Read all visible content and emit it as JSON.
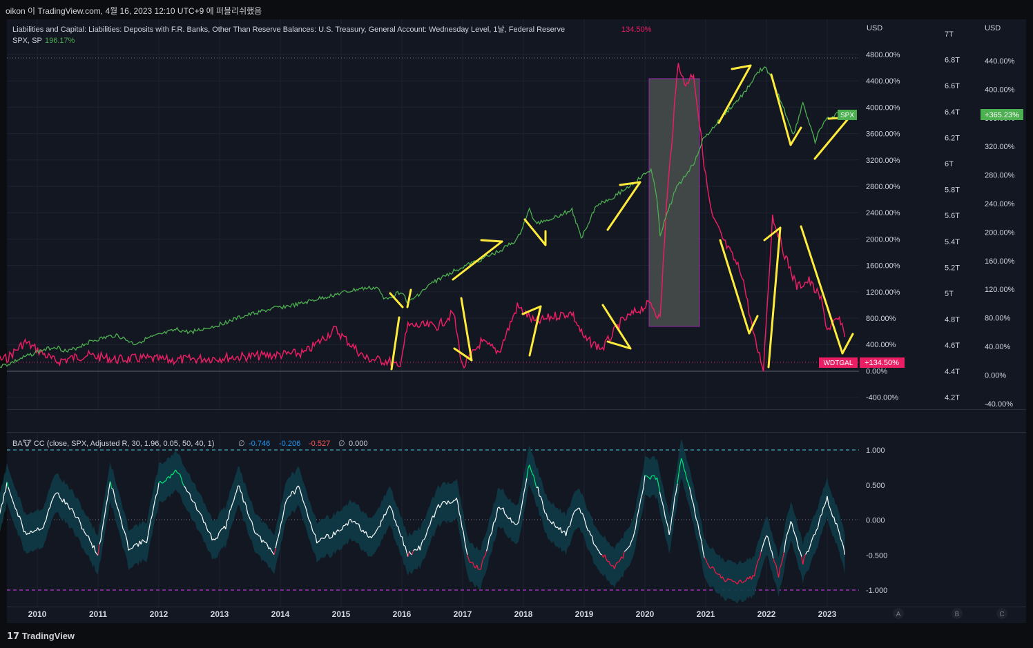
{
  "header": {
    "publish_line": "oikon 이 TradingView.com, 4월 16, 2023 12:10 UTC+9 에 퍼블리쉬했음"
  },
  "legend": {
    "main_series_title": "Liabilities and Capital: Liabilities: Deposits with F.R. Banks, Other Than Reserve Balances: U.S. Treasury, General Account: Wednesday Level, 1날, Federal Reserve",
    "main_series_value": "134.50%",
    "compare_series_title": "SPX, SP",
    "compare_series_value": "196.17%",
    "indicator_title": "BA🐮 CC (close, SPX, Adjusted R, 30, 1.96, 0.05, 50, 40, 1)",
    "indicator_v1": "-0.746",
    "indicator_v2": "-0.206",
    "indicator_v3": "-0.527",
    "indicator_v4": "0.000",
    "empty_symbol": "∅"
  },
  "axes": {
    "currency_label": "USD",
    "pct_axis_ticks": [
      "4800.00%",
      "4400.00%",
      "4000.00%",
      "3600.00%",
      "3200.00%",
      "2800.00%",
      "2400.00%",
      "2000.00%",
      "1600.00%",
      "1200.00%",
      "800.00%",
      "400.00%",
      "0.00%",
      "-400.00%"
    ],
    "t_axis_ticks": [
      "7T",
      "6.8T",
      "6.6T",
      "6.4T",
      "6.2T",
      "6T",
      "5.8T",
      "5.6T",
      "5.4T",
      "5.2T",
      "5T",
      "4.8T",
      "4.6T",
      "4.4T",
      "4.2T"
    ],
    "right_pct_ticks": [
      "440.00%",
      "400.00%",
      "360.00%",
      "320.00%",
      "280.00%",
      "240.00%",
      "200.00%",
      "160.00%",
      "120.00%",
      "80.00%",
      "40.00%",
      "0.00%",
      "-40.00%"
    ],
    "cc_axis_ticks": [
      "1.000",
      "0.500",
      "0.000",
      "-0.500",
      "-1.000"
    ],
    "years": [
      "2010",
      "2011",
      "2012",
      "2013",
      "2014",
      "2015",
      "2016",
      "2017",
      "2018",
      "2019",
      "2020",
      "2021",
      "2022",
      "2023"
    ],
    "scale_buttons": [
      "A",
      "B",
      "C"
    ]
  },
  "badges": {
    "spx_label": "SPX",
    "spx_value": "+365.23%",
    "wdtgal_label": "WDTGAL",
    "wdtgal_value": "+134.50%"
  },
  "colors": {
    "background": "#131722",
    "spx_line": "#4caf50",
    "wdtgal_line": "#e91e63",
    "arrow": "#ffeb3b",
    "highlight_box_fill": "#4a4f4e",
    "highlight_box_border": "#9c27b0",
    "cc_line": "#ffffff",
    "cc_positive": "#00e676",
    "cc_negative": "#ff1744",
    "cc_band": "#0e3b47",
    "upper_band_line": "#4dd0e1",
    "lower_band_line": "#e040fb"
  },
  "footer": {
    "brand": "TradingView"
  },
  "chart_data": [
    {
      "type": "line",
      "series": [
        {
          "name": "SPX, SP",
          "x": [
            2009.0,
            2009.5,
            2010.0,
            2010.3,
            2010.5,
            2010.9,
            2011.3,
            2011.6,
            2011.8,
            2012.3,
            2012.5,
            2012.9,
            2013.3,
            2013.6,
            2013.9,
            2014.3,
            2014.6,
            2014.9,
            2015.3,
            2015.6,
            2015.7,
            2016.0,
            2016.1,
            2016.5,
            2016.9,
            2017.3,
            2017.6,
            2017.9,
            2018.1,
            2018.2,
            2018.5,
            2018.8,
            2018.95,
            2019.2,
            2019.5,
            2019.8,
            2020.1,
            2020.2,
            2020.25,
            2020.5,
            2020.8,
            2020.95,
            2021.3,
            2021.6,
            2021.9,
            2022.0,
            2022.2,
            2022.45,
            2022.6,
            2022.75,
            2022.8,
            2022.95,
            2023.2,
            2023.29
          ],
          "values": [
            0,
            100,
            300,
            380,
            300,
            470,
            560,
            420,
            500,
            640,
            600,
            690,
            820,
            900,
            970,
            1030,
            1110,
            1180,
            1270,
            1290,
            1110,
            1230,
            1050,
            1360,
            1570,
            1720,
            1850,
            2030,
            2490,
            2280,
            2370,
            2490,
            2050,
            2560,
            2700,
            2890,
            3110,
            2660,
            2100,
            2800,
            3200,
            3560,
            3950,
            4250,
            4650,
            4670,
            4250,
            3640,
            4150,
            3670,
            3550,
            3850,
            4000,
            3970
          ]
        },
        {
          "name": "WDTGAL",
          "x": [
            2009.0,
            2009.5,
            2009.8,
            2010.3,
            2010.8,
            2011.3,
            2011.7,
            2012.2,
            2012.8,
            2013.3,
            2013.9,
            2014.4,
            2014.9,
            2015.4,
            2015.8,
            2015.95,
            2016.1,
            2016.6,
            2016.85,
            2017.0,
            2017.3,
            2017.6,
            2017.9,
            2018.2,
            2018.5,
            2018.8,
            2019.0,
            2019.3,
            2019.6,
            2019.9,
            2020.1,
            2020.25,
            2020.35,
            2020.55,
            2020.65,
            2020.8,
            2020.9,
            2021.0,
            2021.1,
            2021.3,
            2021.6,
            2021.8,
            2021.95,
            2022.1,
            2022.3,
            2022.5,
            2022.7,
            2022.9,
            2023.0,
            2023.2,
            2023.29
          ],
          "values": [
            100,
            200,
            450,
            150,
            250,
            180,
            200,
            170,
            200,
            220,
            250,
            280,
            650,
            200,
            150,
            50,
            700,
            700,
            900,
            50,
            450,
            300,
            1000,
            750,
            850,
            900,
            500,
            350,
            750,
            950,
            1050,
            800,
            2500,
            4800,
            4400,
            4600,
            3800,
            3000,
            2400,
            2000,
            1500,
            500,
            50,
            2400,
            1800,
            1300,
            1400,
            1100,
            650,
            800,
            530
          ]
        }
      ],
      "units": "% change",
      "ylim": [
        -400,
        4800
      ]
    },
    {
      "type": "line",
      "series": [
        {
          "name": "BA CC",
          "x": [
            2009.0,
            2009.3,
            2009.5,
            2009.8,
            2010.1,
            2010.3,
            2010.6,
            2011.0,
            2011.2,
            2011.5,
            2011.8,
            2012.0,
            2012.3,
            2012.6,
            2012.9,
            2013.1,
            2013.3,
            2013.6,
            2013.9,
            2014.1,
            2014.3,
            2014.6,
            2014.9,
            2015.2,
            2015.5,
            2015.8,
            2016.1,
            2016.3,
            2016.6,
            2016.9,
            2017.1,
            2017.3,
            2017.6,
            2017.9,
            2018.1,
            2018.4,
            2018.7,
            2018.9,
            2019.2,
            2019.5,
            2019.8,
            2020.0,
            2020.2,
            2020.4,
            2020.6,
            2020.8,
            2021.0,
            2021.3,
            2021.5,
            2021.8,
            2022.0,
            2022.2,
            2022.4,
            2022.6,
            2022.8,
            2023.0,
            2023.2,
            2023.29
          ],
          "values": [
            0.1,
            -0.2,
            0.5,
            -0.2,
            -0.1,
            0.4,
            0.1,
            -0.5,
            0.55,
            -0.4,
            -0.3,
            0.5,
            0.7,
            0.2,
            -0.3,
            -0.1,
            0.5,
            -0.2,
            -0.5,
            0.3,
            0.45,
            -0.3,
            -0.2,
            0.0,
            -0.3,
            0.2,
            -0.5,
            -0.4,
            0.2,
            0.3,
            -0.6,
            -0.7,
            0.2,
            -0.1,
            0.8,
            0.0,
            -0.2,
            0.2,
            -0.4,
            -0.7,
            -0.3,
            0.6,
            0.6,
            -0.2,
            0.9,
            0.2,
            -0.6,
            -0.85,
            -0.9,
            -0.8,
            -0.2,
            -0.8,
            0.0,
            -0.6,
            -0.2,
            0.3,
            -0.2,
            -0.5
          ]
        }
      ],
      "ylim": [
        -1.0,
        1.0
      ]
    }
  ]
}
